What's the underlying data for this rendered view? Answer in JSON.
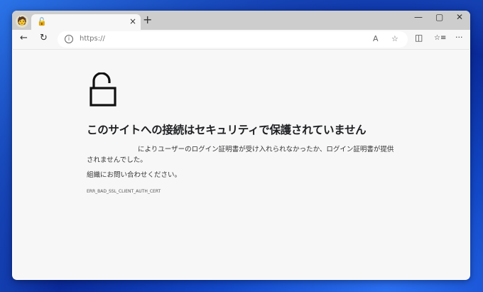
{
  "tab": {
    "close": "×",
    "new": "+"
  },
  "window": {
    "minimize": "—",
    "maximize": "▢",
    "close": "✕"
  },
  "address": {
    "url": "https://",
    "read_aloud": "A",
    "favorite": "☆"
  },
  "toolbar": {
    "back": "←",
    "reload": "↻",
    "split": "◫",
    "favorites": "☆≡",
    "more": "···"
  },
  "page": {
    "title": "このサイトへの接続はセキュリティで保護されていません",
    "message": "によりユーザーのログイン証明書が受け入れられなかったか、ログイン証明書が提供されませんでした。",
    "contact": "組織にお問い合わせください。",
    "error_code": "ERR_BAD_SSL_CLIENT_AUTH_CERT"
  }
}
